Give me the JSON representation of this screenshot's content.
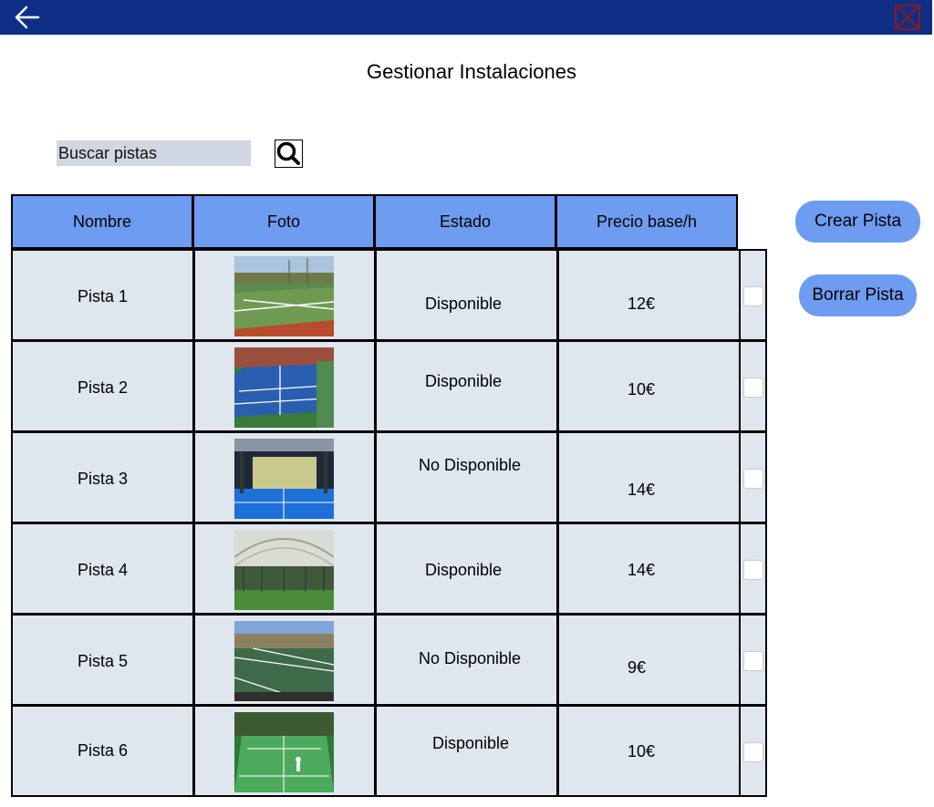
{
  "page": {
    "title": "Gestionar Instalaciones"
  },
  "search": {
    "placeholder": "Buscar pistas"
  },
  "icons": {
    "back": "arrow-left-icon",
    "close": "close-x-icon",
    "search": "magnifier-icon"
  },
  "table": {
    "headers": [
      "Nombre",
      "Foto",
      "Estado",
      "Precio base/h"
    ],
    "rows": [
      {
        "nombre": "Pista 1",
        "estado": "Disponible",
        "precio": "12€"
      },
      {
        "nombre": "Pista 2",
        "estado": "Disponible",
        "precio": "10€"
      },
      {
        "nombre": "Pista 3",
        "estado": "No Disponible",
        "precio": "14€"
      },
      {
        "nombre": "Pista 4",
        "estado": "Disponible",
        "precio": "14€"
      },
      {
        "nombre": "Pista 5",
        "estado": "No Disponible",
        "precio": "9€"
      },
      {
        "nombre": "Pista 6",
        "estado": "Disponible",
        "precio": "10€"
      }
    ]
  },
  "actions": {
    "crear": "Crear Pista",
    "borrar": "Borrar Pista"
  },
  "colors": {
    "topbar": "#0f2f86",
    "accent": "#6d9cf0",
    "row_bg": "#dfe6ee",
    "close": "#8b1a1a"
  }
}
